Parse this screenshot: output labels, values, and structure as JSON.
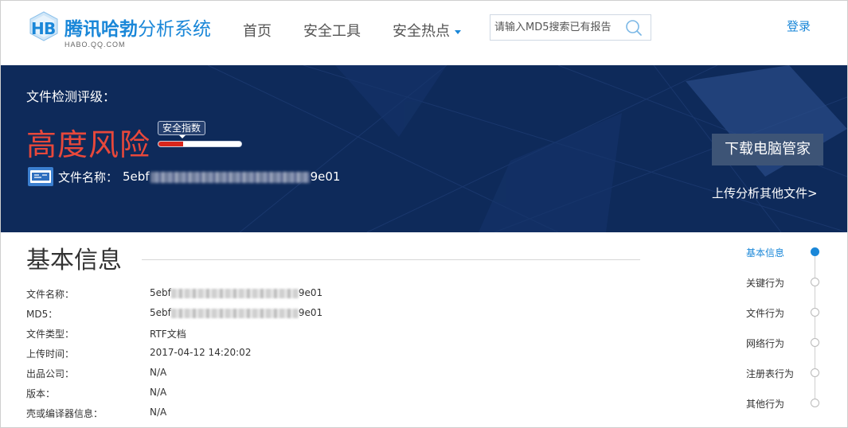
{
  "header": {
    "logo_bold": "腾讯哈勃",
    "logo_normal": "分析系统",
    "logo_sub": "HABO.QQ.COM",
    "nav": [
      "首页",
      "安全工具",
      "安全热点"
    ],
    "search_placeholder": "请输入MD5搜索已有报告",
    "login": "登录"
  },
  "banner": {
    "rating_label": "文件检测评级：",
    "risk_level": "高度风险",
    "safety_tag": "安全指数",
    "safety_fraction": 0.3,
    "file_name_label": "文件名称：",
    "file_name_start": "5ebf",
    "file_name_end": "9e01",
    "download_button": "下载电脑管家",
    "upload_link": "上传分析其他文件>",
    "colors": {
      "background": "#0e2a5a",
      "risk": "#e8483b",
      "bar_fill": "#d8261c"
    }
  },
  "basic_info": {
    "title": "基本信息",
    "rows": [
      {
        "key": "文件名称：",
        "value_start": "5ebf",
        "value_end": "9e01",
        "redacted": true
      },
      {
        "key": "MD5：",
        "value_start": "5ebf",
        "value_end": "9e01",
        "redacted": true
      },
      {
        "key": "文件类型：",
        "value": "RTF文档"
      },
      {
        "key": "上传时间：",
        "value": "2017-04-12 14:20:02"
      },
      {
        "key": "出品公司：",
        "value": "N/A"
      },
      {
        "key": "版本：",
        "value": "N/A"
      },
      {
        "key": "壳或编译器信息：",
        "value": "N/A"
      }
    ]
  },
  "side_nav": {
    "items": [
      "基本信息",
      "关键行为",
      "文件行为",
      "网络行为",
      "注册表行为",
      "其他行为"
    ],
    "active_index": 0
  },
  "icons": {
    "logo": "habo-logo-icon",
    "search": "search-icon",
    "file_type": "rtf-file-icon",
    "caret": "caret-down-icon"
  }
}
